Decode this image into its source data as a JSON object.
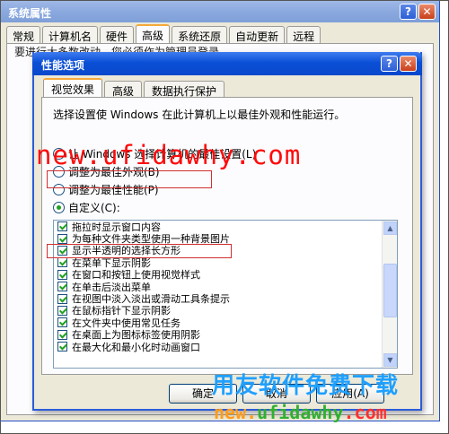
{
  "back_window": {
    "title": "系统属性",
    "tabs": [
      "常规",
      "计算机名",
      "硬件",
      "高级",
      "系统还原",
      "自动更新",
      "远程"
    ],
    "active_tab": 3,
    "note": "要进行大多数改动，您必须作为管理员登录。"
  },
  "dialog": {
    "title": "性能选项",
    "help_glyph": "?",
    "close_glyph": "✕",
    "tabs": [
      "视觉效果",
      "高级",
      "数据执行保护"
    ],
    "active_tab": 0,
    "description": "选择设置使 Windows 在此计算机上以最佳外观和性能运行。",
    "options": [
      {
        "label": "让 Windows 选择计算机的最佳设置(L)",
        "selected": false
      },
      {
        "label": "调整为最佳外观(B)",
        "selected": false
      },
      {
        "label": "调整为最佳性能(P)",
        "selected": false
      },
      {
        "label": "自定义(C):",
        "selected": true
      }
    ],
    "effects": [
      {
        "label": "拖拉时显示窗口内容",
        "checked": true
      },
      {
        "label": "为每种文件夹类型使用一种背景图片",
        "checked": true
      },
      {
        "label": "显示半透明的选择长方形",
        "checked": true
      },
      {
        "label": "在菜单下显示阴影",
        "checked": true
      },
      {
        "label": "在窗口和按钮上使用视觉样式",
        "checked": true
      },
      {
        "label": "在单击后淡出菜单",
        "checked": true
      },
      {
        "label": "在视图中淡入淡出或滑动工具条提示",
        "checked": true
      },
      {
        "label": "在鼠标指针下显示阴影",
        "checked": true
      },
      {
        "label": "在文件夹中使用常见任务",
        "checked": true
      },
      {
        "label": "在桌面上为图标标签使用阴影",
        "checked": true
      },
      {
        "label": "在最大化和最小化时动画窗口",
        "checked": true
      }
    ],
    "buttons": {
      "ok": "确定",
      "cancel": "取消",
      "apply": "应用(A)"
    }
  },
  "watermarks": {
    "url_top": "new.ufidawhy.com",
    "cn_text": "用友软件免费下载",
    "url_bottom_1": "new.",
    "url_bottom_2": "ufidawhy",
    "url_bottom_3": ".com"
  },
  "colors": {
    "titlebar": "#0a4fd6",
    "checkmark": "#21a121",
    "highlight_box": "#d03030",
    "watermark_red": "#ff0a0a",
    "watermark_blue": "#1fa0ff"
  }
}
